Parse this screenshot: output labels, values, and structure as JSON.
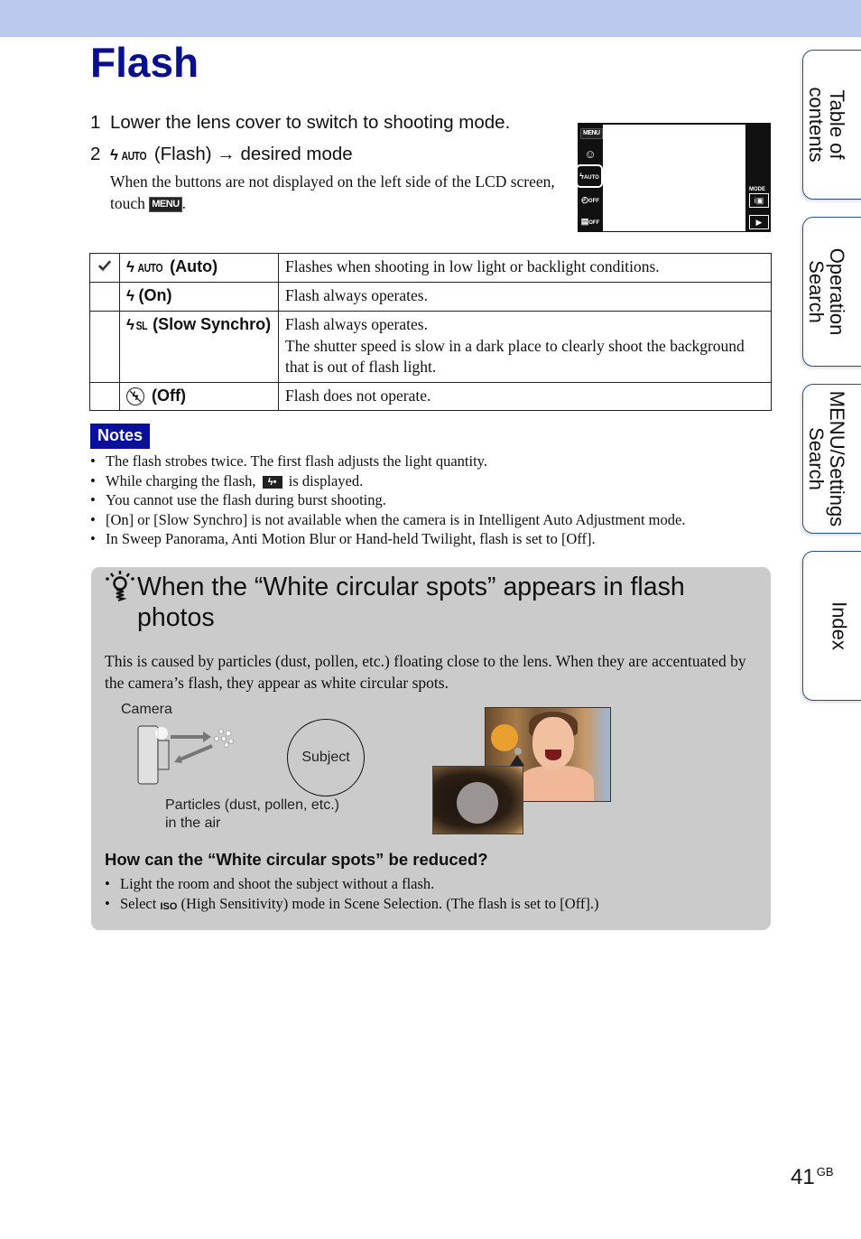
{
  "page": {
    "title": "Flash",
    "number": "41",
    "region": "GB"
  },
  "steps": [
    {
      "num": "1",
      "text": "Lower the lens cover to switch to shooting mode."
    },
    {
      "num": "2",
      "icon": "flash-auto-icon",
      "icon_text": "AUTO",
      "text": "(Flash) → desired mode",
      "note_before": "When the buttons are not displayed on the left side of the LCD screen, touch ",
      "note_menu": "MENU",
      "note_after": "."
    }
  ],
  "lcd": {
    "left_buttons": [
      "MENU",
      "☺",
      "AUTO",
      "OFF",
      "OFF"
    ],
    "mode_label": "MODE",
    "right_buttons": [
      "i▣",
      "▶"
    ]
  },
  "modes": [
    {
      "default": true,
      "icon": "flash-auto-icon",
      "icon_sub": "AUTO",
      "name": "(Auto)",
      "desc": [
        "Flashes when shooting in low light or backlight conditions."
      ]
    },
    {
      "default": false,
      "icon": "flash-on-icon",
      "icon_sub": "",
      "name": "(On)",
      "desc": [
        "Flash always operates."
      ]
    },
    {
      "default": false,
      "icon": "flash-slow-synchro-icon",
      "icon_sub": "SL",
      "name": "(Slow Synchro)",
      "desc": [
        "Flash always operates.",
        "The shutter speed is slow in a dark place to clearly shoot the background that is out of flash light."
      ]
    },
    {
      "default": false,
      "icon": "flash-off-icon",
      "icon_sub": "",
      "name": "(Off)",
      "desc": [
        "Flash does not operate."
      ]
    }
  ],
  "notes": {
    "label": "Notes",
    "items": [
      "The flash strobes twice. The first flash adjusts the light quantity.",
      {
        "before": "While charging the flash, ",
        "icon": "flash-charging-icon",
        "after": " is displayed."
      },
      "You cannot use the flash during burst shooting.",
      "[On] or [Slow Synchro] is not available when the camera is in Intelligent Auto Adjustment mode.",
      "In Sweep Panorama, Anti Motion Blur or Hand-held Twilight, flash is set to [Off]."
    ]
  },
  "hint": {
    "icon": "lightbulb-hint-icon",
    "title": "When the “White circular spots” appears in flash photos",
    "paragraph": "This is caused by particles (dust, pollen, etc.) floating close to the lens. When they are accentuated by the camera’s flash, they appear as white circular spots.",
    "diagram": {
      "camera_label": "Camera",
      "subject_label": "Subject",
      "particles_label_1": "Particles (dust, pollen, etc.)",
      "particles_label_2": "in the air"
    },
    "question": "How can the “White circular spots” be reduced?",
    "tips": [
      "Light the room and shoot the subject without a flash.",
      {
        "before": "Select ",
        "icon": "high-sensitivity-iso-icon",
        "icon_text": "ISO",
        "after": " (High Sensitivity) mode in Scene Selection. (The flash is set to [Off].)"
      }
    ]
  },
  "side_tabs": [
    {
      "label_1": "Table of",
      "label_2": "contents"
    },
    {
      "label_1": "Operation",
      "label_2": "Search"
    },
    {
      "label_1": "MENU/Settings",
      "label_2": "Search"
    },
    {
      "label_1": "Index",
      "label_2": ""
    }
  ]
}
